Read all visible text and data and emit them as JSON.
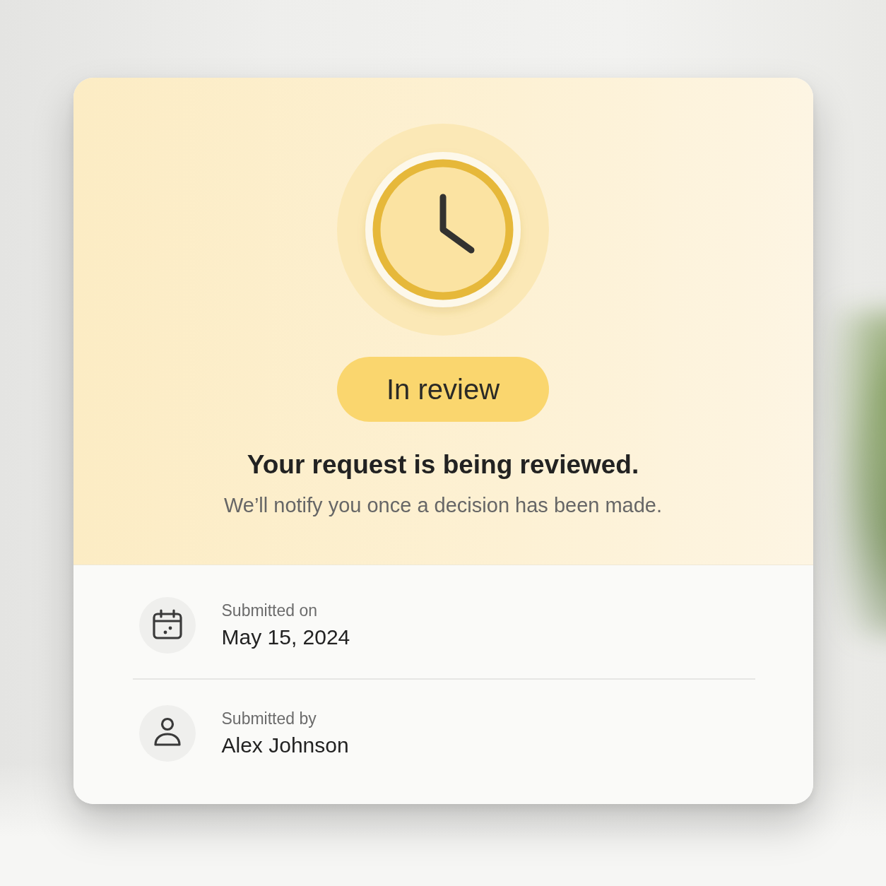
{
  "status": {
    "badge": "In review",
    "title": "Your request is being reviewed.",
    "message": "We’ll notify you once a decision has been made."
  },
  "details": [
    {
      "kind": "date",
      "label": "Submitted on",
      "value": "May 15, 2024"
    },
    {
      "kind": "person",
      "label": "Submitted by",
      "value": "Alex Johnson"
    }
  ]
}
